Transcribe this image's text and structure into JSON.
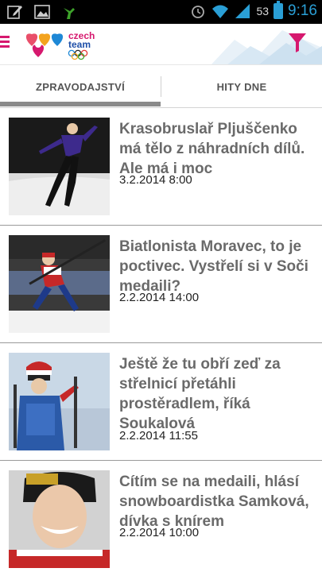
{
  "status_bar": {
    "icons_left": [
      "edit-icon",
      "image-icon",
      "android-icon"
    ],
    "icons_right": [
      "alarm-icon",
      "wifi-icon",
      "signal-icon",
      "battery-icon"
    ],
    "battery_percent": "53",
    "time": "9:16"
  },
  "app_bar": {
    "logo_icon": "czech-team-logo",
    "filter_icon": "filter-icon",
    "logo_text": [
      "czech",
      "team"
    ],
    "accent_color": "#d6186e"
  },
  "tabs": [
    {
      "label": "ZPRAVODAJSTVÍ",
      "active": true
    },
    {
      "label": "HITY DNE",
      "active": false
    }
  ],
  "articles": [
    {
      "title": "Krasobruslař Pljuščenko má tělo z náhradních dílů. Ale má i moc",
      "date": "3.2.2014 8:00"
    },
    {
      "title": "Biatlonista Moravec, to je poctivec. Vystřelí si v Soči medaili?",
      "date": "2.2.2014 14:00"
    },
    {
      "title": "Ještě že tu obří zeď za střelnicí přetáhli prostěradlem, říká Soukalová",
      "date": "2.2.2014 11:55"
    },
    {
      "title": "Cítím se na medaili, hlásí snowboardistka Samková, dívka s knírem",
      "date": "2.2.2014 10:00"
    }
  ]
}
